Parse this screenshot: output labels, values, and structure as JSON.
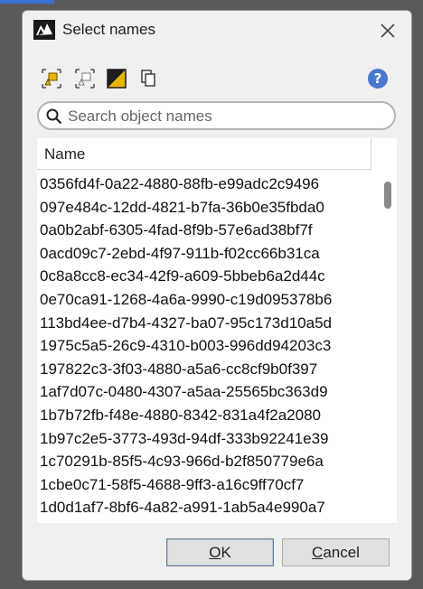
{
  "window": {
    "title": "Select names"
  },
  "icons": {
    "app": "rhino-app-icon",
    "close": "close-icon",
    "toolbar": [
      "select-all-icon",
      "select-none-icon",
      "invert-selection-icon",
      "copy-icon"
    ],
    "help": "help-icon",
    "search": "search-icon"
  },
  "toolbar": {
    "help_label": "?"
  },
  "search": {
    "placeholder": "Search object names",
    "value": ""
  },
  "list": {
    "column_header": "Name",
    "rows": [
      "0356fd4f-0a22-4880-88fb-e99adc2c9496",
      "097e484c-12dd-4821-b7fa-36b0e35fbda0",
      "0a0b2abf-6305-4fad-8f9b-57e6ad38bf7f",
      "0acd09c7-2ebd-4f97-911b-f02cc66b31ca",
      "0c8a8cc8-ec34-42f9-a609-5bbeb6a2d44c",
      "0e70ca91-1268-4a6a-9990-c19d095378b6",
      "113bd4ee-d7b4-4327-ba07-95c173d10a5d",
      "1975c5a5-26c9-4310-b003-996dd94203c3",
      "197822c3-3f03-4880-a5a6-cc8cf9b0f397",
      "1af7d07c-0480-4307-a5aa-25565bc363d9",
      "1b7b72fb-f48e-4880-8342-831a4f2a2080",
      "1b97c2e5-3773-493d-94df-333b92241e39",
      "1c70291b-85f5-4c93-966d-b2f850779e6a",
      "1cbe0c71-58f5-4688-9ff3-a16c9ff70cf7",
      "1d0d1af7-8bf6-4a82-a991-1ab5a4e990a7"
    ]
  },
  "buttons": {
    "ok": {
      "mnemonic": "O",
      "rest": "K"
    },
    "cancel": {
      "mnemonic": "C",
      "rest": "ancel"
    }
  },
  "colors": {
    "accent": "#4a78cf",
    "select_highlight": "#e8b400"
  }
}
